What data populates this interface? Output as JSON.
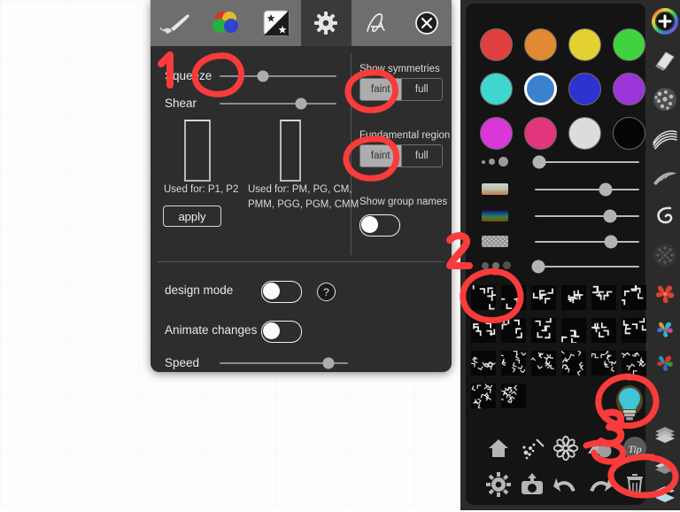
{
  "app": {
    "name": "Symmetry Design Tool",
    "background": "white-grid-canvas"
  },
  "dialog": {
    "title": "settings-panel",
    "tabs": [
      {
        "id": "brush",
        "icon": "paintbrush-icon",
        "label": "Brush",
        "active": false
      },
      {
        "id": "color",
        "icon": "color-wheel-icon",
        "label": "Color",
        "active": false
      },
      {
        "id": "contrast",
        "icon": "star-contrast-icon",
        "label": "Effects",
        "active": false
      },
      {
        "id": "settings",
        "icon": "gear-icon",
        "label": "Settings",
        "active": true
      },
      {
        "id": "text",
        "icon": "script-a-icon",
        "label": "Text",
        "active": false
      },
      {
        "id": "close",
        "icon": "close-icon",
        "label": "Close",
        "active": false
      }
    ],
    "left": {
      "squeeze_label": "Squeeze",
      "squeeze_value": 37,
      "shear_label": "Shear",
      "shear_value": 70,
      "cell_a_caption": "Used for: P1, P2",
      "cell_b_caption": "Used for: PM, PG, CM,\nPMM, PGG, PGM, CMM",
      "cell_b_line1": "Used for: PM, PG, CM,",
      "cell_b_line2": "PMM, PGG, PGM, CMM",
      "apply_label": "apply"
    },
    "right": {
      "show_symmetries_label": "Show symmetries",
      "show_symmetries_options": [
        "faint",
        "full"
      ],
      "show_symmetries_selected": "faint",
      "fundamental_region_label": "Fundamental region",
      "fundamental_region_options": [
        "faint",
        "full"
      ],
      "fundamental_region_selected": "faint",
      "show_group_names_label": "Show group names",
      "show_group_names_on": false
    },
    "bottom": {
      "design_mode_label": "design mode",
      "design_mode_on": false,
      "help_label": "?",
      "animate_changes_label": "Animate changes",
      "animate_changes_on": false,
      "speed_label": "Speed",
      "speed_value": 85
    }
  },
  "palette": {
    "swatches": [
      {
        "name": "red",
        "color": "#e04040",
        "selected": false
      },
      {
        "name": "orange",
        "color": "#e08a33",
        "selected": false
      },
      {
        "name": "yellow",
        "color": "#e3d133",
        "selected": false
      },
      {
        "name": "green",
        "color": "#3fd43f",
        "selected": false
      },
      {
        "name": "cyan",
        "color": "#3fd6cf",
        "selected": false
      },
      {
        "name": "blue",
        "color": "#3a82cf",
        "selected": true
      },
      {
        "name": "indigo",
        "color": "#2e33cf",
        "selected": false
      },
      {
        "name": "purple",
        "color": "#9c35d8",
        "selected": false
      },
      {
        "name": "magenta",
        "color": "#da36d8",
        "selected": false
      },
      {
        "name": "pink",
        "color": "#e2357c",
        "selected": false
      },
      {
        "name": "white",
        "color": "#dcdcdc",
        "selected": false
      },
      {
        "name": "black",
        "color": "#050505",
        "selected": false
      }
    ],
    "sliders": [
      {
        "name": "brush-size",
        "icon": "dots-size-icon",
        "value": 4
      },
      {
        "name": "color-blend",
        "icon": "gradient-light-icon",
        "value": 68
      },
      {
        "name": "hue-shift",
        "icon": "gradient-dark-icon",
        "value": 72
      },
      {
        "name": "opacity",
        "icon": "checker-icon",
        "value": 73
      },
      {
        "name": "spacing",
        "icon": "dots-fade-icon",
        "value": 3
      }
    ],
    "patterns_count": 20,
    "selected_pattern_index": 0
  },
  "toolbar": {
    "row1": [
      {
        "name": "home-icon",
        "label": "Home"
      },
      {
        "name": "magic-wand-icon",
        "label": "Magic"
      },
      {
        "name": "flower-icon",
        "label": "Flower"
      },
      {
        "name": "shapes-icon",
        "label": "Shapes"
      },
      {
        "name": "tip-button",
        "label": "Tip"
      }
    ],
    "row2": [
      {
        "name": "gear-icon",
        "label": "Settings"
      },
      {
        "name": "camera-icon",
        "label": "Export"
      },
      {
        "name": "undo-icon",
        "label": "Undo"
      },
      {
        "name": "redo-icon",
        "label": "Redo"
      },
      {
        "name": "trash-icon",
        "label": "Delete"
      }
    ]
  },
  "side_strip": [
    {
      "name": "add-color-icon",
      "label": "Add color"
    },
    {
      "name": "eraser-icon",
      "label": "Eraser"
    },
    {
      "name": "texture-ball-icon",
      "label": "Texture"
    },
    {
      "name": "ribbon-icon",
      "label": "Ribbon"
    },
    {
      "name": "feather-icon",
      "label": "Feather"
    },
    {
      "name": "curve-icon",
      "label": "Curve"
    },
    {
      "name": "dotted-disc-icon",
      "label": "Dotted disc"
    },
    {
      "name": "pinwheel-red-icon",
      "label": "Pinwheel red"
    },
    {
      "name": "pinwheel-cyan-icon",
      "label": "Pinwheel cyan"
    },
    {
      "name": "pinwheel-multi-icon",
      "label": "Pinwheel multi"
    },
    {
      "name": "layers-icon",
      "label": "Layers"
    },
    {
      "name": "layer-single-icon",
      "label": "Layer"
    },
    {
      "name": "layer-bottom-icon",
      "label": "Bottom layer"
    }
  ],
  "annotations": {
    "accent_color": "#f93b3b",
    "marks": [
      {
        "name": "annotation-number-1",
        "text": "1"
      },
      {
        "name": "annotation-number-2",
        "text": "2"
      },
      {
        "name": "annotation-number-3",
        "text": "3"
      },
      {
        "name": "circle-squeeze-slider",
        "text": ""
      },
      {
        "name": "circle-show-symmetries-faint",
        "text": ""
      },
      {
        "name": "circle-fundamental-region-faint",
        "text": ""
      },
      {
        "name": "circle-pattern-first",
        "text": ""
      },
      {
        "name": "circle-lightbulb",
        "text": ""
      },
      {
        "name": "circle-layer-bottom",
        "text": ""
      }
    ]
  }
}
